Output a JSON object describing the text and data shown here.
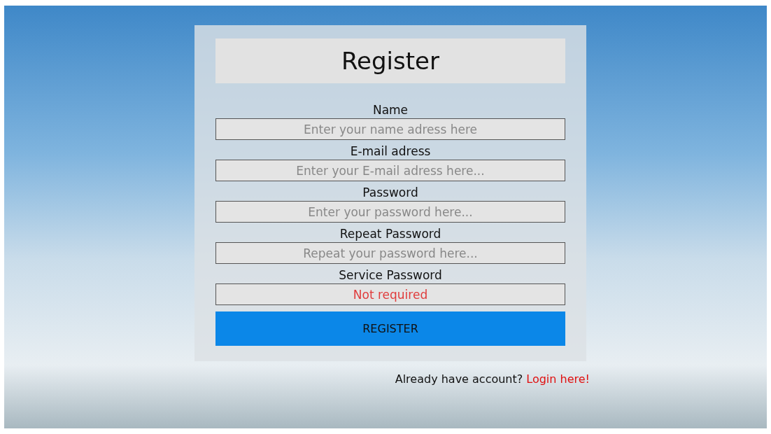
{
  "form": {
    "title": "Register",
    "fields": [
      {
        "label": "Name",
        "placeholder": "Enter your name adress here"
      },
      {
        "label": "E-mail adress",
        "placeholder": "Enter your E-mail adress here..."
      },
      {
        "label": "Password",
        "placeholder": "Enter your password here..."
      },
      {
        "label": "Repeat Password",
        "placeholder": "Repeat your password here..."
      },
      {
        "label": "Service Password",
        "placeholder": "Not required",
        "color": "#e03c3c"
      }
    ],
    "submit": "REGISTER"
  },
  "footer": {
    "text": "Already have account?",
    "link": "Login here!"
  }
}
